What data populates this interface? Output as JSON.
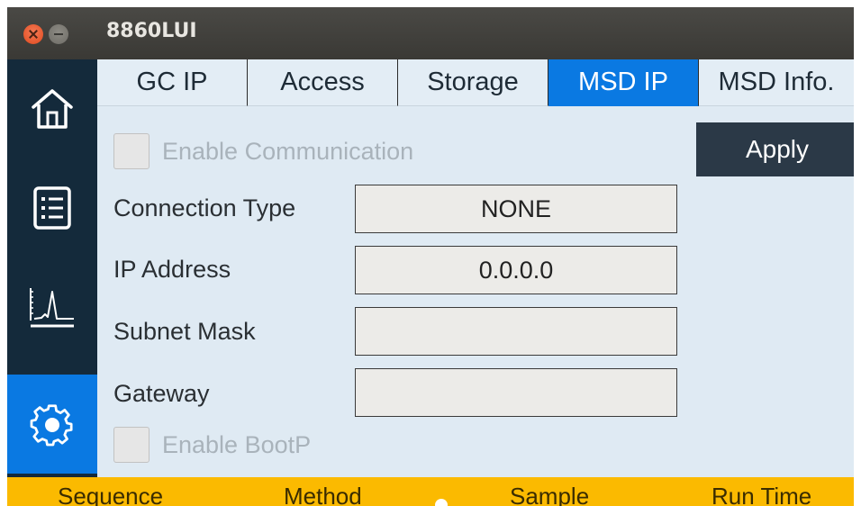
{
  "window": {
    "title": "8860LUI"
  },
  "sidebar": {
    "items": [
      {
        "icon": "home-icon",
        "active": false
      },
      {
        "icon": "list-icon",
        "active": false
      },
      {
        "icon": "chromatogram-icon",
        "active": false
      },
      {
        "icon": "gear-icon",
        "active": true
      }
    ]
  },
  "tabs": [
    {
      "label": "GC IP",
      "active": false
    },
    {
      "label": "Access",
      "active": false
    },
    {
      "label": "Storage",
      "active": false
    },
    {
      "label": "MSD IP",
      "active": true
    },
    {
      "label": "MSD Info.",
      "active": false
    }
  ],
  "form": {
    "enable_communication": {
      "label": "Enable Communication",
      "checked": false,
      "enabled": false
    },
    "apply_label": "Apply",
    "connection_type": {
      "label": "Connection Type",
      "value": "NONE"
    },
    "ip_address": {
      "label": "IP Address",
      "value": "0.0.0.0"
    },
    "subnet_mask": {
      "label": "Subnet Mask",
      "value": ""
    },
    "gateway": {
      "label": "Gateway",
      "value": ""
    },
    "enable_bootp": {
      "label": "Enable BootP",
      "checked": false,
      "enabled": false
    }
  },
  "bottombar": {
    "items": [
      "Sequence",
      "Method",
      "Sample",
      "Run Time"
    ]
  },
  "colors": {
    "accent": "#0a79e2",
    "sidebar_bg": "#142a3b",
    "content_bg": "#dfeaf3",
    "status_bar": "#fbba00",
    "apply_bg": "#2b3947"
  }
}
